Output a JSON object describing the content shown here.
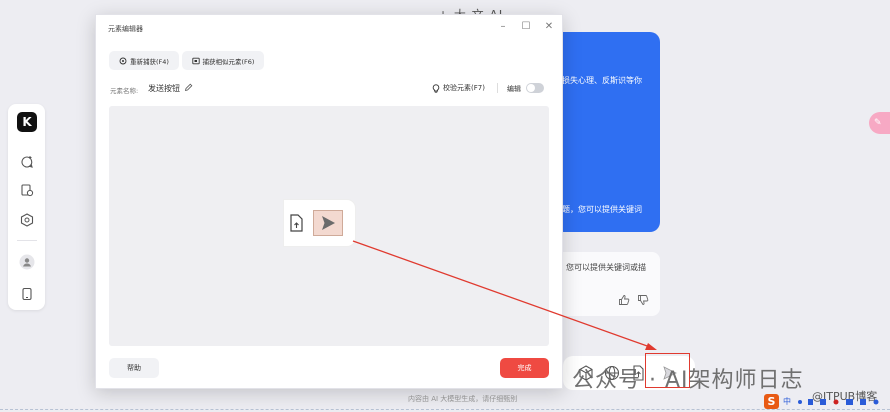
{
  "app": {
    "title": "+ 大 文 AI",
    "footer_note": "内容由 AI 大模型生成，请仔细甄别"
  },
  "sidebar": {
    "logo_text": "K",
    "icons": [
      "new-chat-icon",
      "history-icon",
      "discover-icon",
      "user-avatar-icon",
      "phone-icon"
    ]
  },
  "chat": {
    "blue_line_1": "损失心理、反斯识等你",
    "blue_line_2": "题，您可以提供关键词",
    "white_line": "您可以提供关键词或描"
  },
  "dialog": {
    "title": "元素编辑器",
    "recapture_label": "重新捕获(F4)",
    "capture_similar_label": "捕获相似元素(F6)",
    "name_label": "元素名称:",
    "name_value": "发送按钮",
    "validate_label": "校验元素(F7)",
    "edit_label": "编辑",
    "edit_toggle_on": false,
    "help_label": "帮助",
    "done_label": "完成"
  },
  "watermark": {
    "text": "公众号 · AI架构师日志",
    "blog": "@ITPUB博客",
    "ime": "中"
  },
  "colors": {
    "accent_blue": "#2f6ff2",
    "done_red": "#ef4a42",
    "annotation_red": "#e03a2f"
  }
}
